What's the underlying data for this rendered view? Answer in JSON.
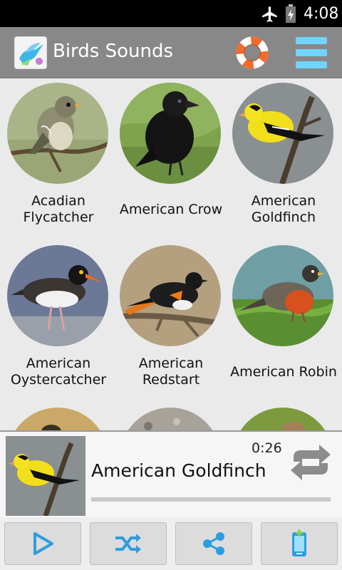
{
  "status_bar": {
    "time": "4:08",
    "icons": [
      "airplane-mode-icon",
      "battery-icon"
    ]
  },
  "app": {
    "title": "Birds Sounds",
    "icon": "app-bird-icon"
  },
  "action_bar": {
    "help_icon": "lifebuoy-icon",
    "menu_icon": "menu-icon"
  },
  "colors": {
    "accent": "#4fc3f7",
    "toolbar": "#888888",
    "menu_bars": "#6fd4ff",
    "help_ring": "#f36b2c"
  },
  "birds": [
    {
      "name": "Acadian\nFlycatcher"
    },
    {
      "name": "American Crow"
    },
    {
      "name": "American\nGoldfinch"
    },
    {
      "name": "American\nOystercatcher"
    },
    {
      "name": "American\nRedstart"
    },
    {
      "name": "American Robin"
    }
  ],
  "player": {
    "title": "American Goldfinch",
    "time": "0:26",
    "progress": 0
  },
  "controls": [
    {
      "icon": "play-icon"
    },
    {
      "icon": "shuffle-icon"
    },
    {
      "icon": "share-icon"
    },
    {
      "icon": "set-ringtone-icon"
    }
  ]
}
